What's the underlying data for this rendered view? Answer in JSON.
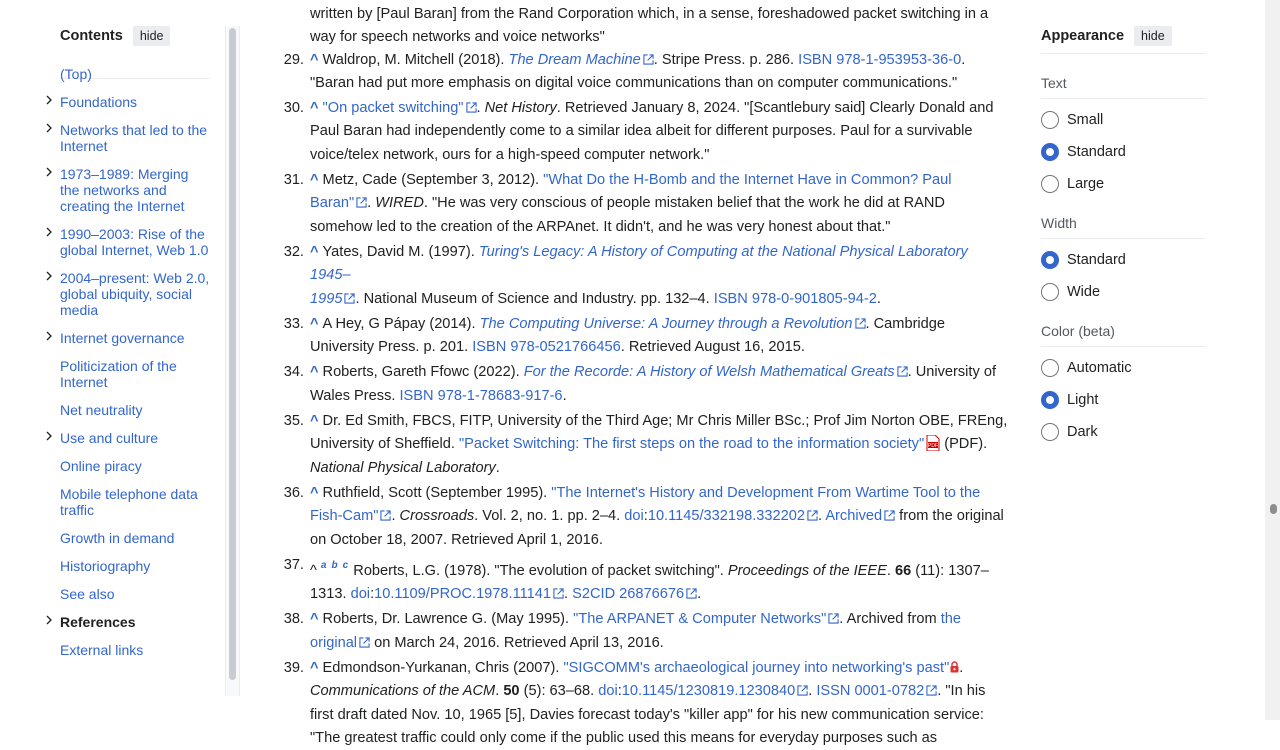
{
  "toc": {
    "title": "Contents",
    "hide_label": "hide",
    "items": [
      {
        "label": "(Top)",
        "expandable": false,
        "bold": false
      },
      {
        "label": "Foundations",
        "expandable": true,
        "bold": false
      },
      {
        "label": "Networks that led to the Internet",
        "expandable": true,
        "bold": false
      },
      {
        "label": "1973–1989: Merging the networks and creating the Internet",
        "expandable": true,
        "bold": false
      },
      {
        "label": "1990–2003: Rise of the global Internet, Web 1.0",
        "expandable": true,
        "bold": false
      },
      {
        "label": "2004–present: Web 2.0, global ubiquity, social media",
        "expandable": true,
        "bold": false
      },
      {
        "label": "Internet governance",
        "expandable": true,
        "bold": false
      },
      {
        "label": "Politicization of the Internet",
        "expandable": false,
        "bold": false
      },
      {
        "label": "Net neutrality",
        "expandable": false,
        "bold": false
      },
      {
        "label": "Use and culture",
        "expandable": true,
        "bold": false
      },
      {
        "label": "Online piracy",
        "expandable": false,
        "bold": false
      },
      {
        "label": "Mobile telephone data traffic",
        "expandable": false,
        "bold": false
      },
      {
        "label": "Growth in demand",
        "expandable": false,
        "bold": false
      },
      {
        "label": "Historiography",
        "expandable": false,
        "bold": false
      },
      {
        "label": "See also",
        "expandable": false,
        "bold": false
      },
      {
        "label": "References",
        "expandable": true,
        "bold": true
      },
      {
        "label": "External links",
        "expandable": false,
        "bold": false
      }
    ]
  },
  "refs": {
    "r28_tail_1": "written by [Paul Baran] from the Rand Corporation which, in a sense, foreshadowed packet switching in a",
    "r28_tail_2": "way for speech networks and voice networks\"",
    "r29": {
      "num": "29.",
      "caret": "^",
      "a": "Waldrop, M. Mitchell (2018). ",
      "title": "The Dream Machine",
      "b": ". Stripe Press. p. 286. ",
      "isbn": "ISBN 978-1-953953-36-0",
      "c": ".",
      "quote": "\"Baran had put more emphasis on digital voice communications than on computer communications.\""
    },
    "r30": {
      "num": "30.",
      "caret": "^",
      "title": "\"On packet switching\"",
      "a": ". ",
      "pub": "Net History",
      "b": ". Retrieved January 8, 2024. \"[Scantlebury said] Clearly Donald and",
      "l2": "Paul Baran had independently come to a similar idea albeit for different purposes. Paul for a survivable",
      "l3": "voice/telex network, ours for a high-speed computer network.\""
    },
    "r31": {
      "num": "31.",
      "caret": "^",
      "a": "Metz, Cade (September 3, 2012). ",
      "title1": "\"What Do the H-Bomb and the Internet Have in Common? Paul",
      "title2": "Baran\"",
      "b": ". ",
      "pub": "WIRED",
      "c": ". \"He was very conscious of people mistaken belief that the work he did at RAND",
      "l3": "somehow led to the creation of the ARPAnet. It didn't, and he was very honest about that.\""
    },
    "r32": {
      "num": "32.",
      "caret": "^",
      "a": "Yates, David M. (1997). ",
      "title1": "Turing's Legacy: A History of Computing at the National Physical Laboratory 1945–",
      "title2": "1995",
      "b": ". National Museum of Science and Industry. pp. 132–4. ",
      "isbn": "ISBN 978-0-901805-94-2",
      "c": "."
    },
    "r33": {
      "num": "33.",
      "caret": "^",
      "a": "A Hey, G Pápay (2014). ",
      "title": "The Computing Universe: A Journey through a Revolution",
      "b": ". Cambridge",
      "l2a": "University Press. p. 201. ",
      "isbn": "ISBN 978-0521766456",
      "c": ". Retrieved August 16, 2015."
    },
    "r34": {
      "num": "34.",
      "caret": "^",
      "a": "Roberts, Gareth Ffowc (2022). ",
      "title": "For the Recorde: A History of Welsh Mathematical Greats",
      "b": ". University of",
      "l2a": "Wales Press. ",
      "isbn": "ISBN 978-1-78683-917-6",
      "c": "."
    },
    "r35": {
      "num": "35.",
      "caret": "^",
      "a": "Dr. Ed Smith, FBCS, FITP, University of the Third Age; Mr Chris Miller BSc.; Prof Jim Norton OBE, FREng,",
      "l2a": "University of Sheffield. ",
      "title": "\"Packet Switching: The first steps on the road to the information society\"",
      "pdf": " (PDF).",
      "pub": "National Physical Laboratory",
      "c": "."
    },
    "r36": {
      "num": "36.",
      "caret": "^",
      "a": "Ruthfield, Scott (September 1995). ",
      "title1": "\"The Internet's History and Development From Wartime Tool to the",
      "title2": "Fish-Cam\"",
      "b": ". ",
      "pub": "Crossroads",
      "c": ". Vol. 2, no. 1. pp. 2–4. ",
      "doi_label": "doi",
      "doi_colon": ":",
      "doi": "10.1145/332198.332202",
      "d": ". ",
      "archived": "Archived",
      "e": " from the original",
      "l3": "on October 18, 2007. Retrieved April 1, 2016."
    },
    "r37": {
      "num": "37.",
      "caret": "^",
      "sup_a": "a",
      "sup_b": "b",
      "sup_c": "c",
      "a": "Roberts, L.G. (1978). \"The evolution of packet switching\". ",
      "pub": "Proceedings of the IEEE",
      "b": ". ",
      "vol": "66",
      "c": " (11): 1307–",
      "l2a": "1313. ",
      "doi_label": "doi",
      "doi_colon": ":",
      "doi": "10.1109/PROC.1978.11141",
      "d": ". ",
      "s2cid": "S2CID 26876676",
      "e": "."
    },
    "r38": {
      "num": "38.",
      "caret": "^",
      "a": "Roberts, Dr. Lawrence G. (May 1995). ",
      "title": "\"The ARPANET & Computer Networks\"",
      "b": ". Archived from ",
      "orig1": "the",
      "orig2": "original",
      "c": " on March 24, 2016. Retrieved April 13, 2016."
    },
    "r39": {
      "num": "39.",
      "caret": "^",
      "a": "Edmondson-Yurkanan, Chris (2007). ",
      "title": "\"SIGCOMM's archaeological journey into networking's past\"",
      "b": ".",
      "pub": "Communications of the ACM",
      "c": ". ",
      "vol": "50",
      "d": " (5): 63–68. ",
      "doi_label": "doi",
      "doi_colon": ":",
      "doi": "10.1145/1230819.1230840",
      "e": ". ",
      "issn": "ISSN 0001-0782",
      "f": ". \"In his",
      "l3": "first draft dated Nov. 10, 1965 [5], Davies forecast today's \"killer app\" for his new communication service:",
      "l4": "\"The greatest traffic could only come if the public used this means for everyday purposes such as"
    }
  },
  "appearance": {
    "title": "Appearance",
    "hide_label": "hide",
    "text_label": "Text",
    "text_options": [
      "Small",
      "Standard",
      "Large"
    ],
    "text_selected": "Standard",
    "width_label": "Width",
    "width_options": [
      "Standard",
      "Wide"
    ],
    "width_selected": "Standard",
    "color_label": "Color (beta)",
    "color_options": [
      "Automatic",
      "Light",
      "Dark"
    ],
    "color_selected": "Light"
  },
  "colors": {
    "link": "#3366cc",
    "text": "#202122",
    "accent": "#3366cc"
  }
}
